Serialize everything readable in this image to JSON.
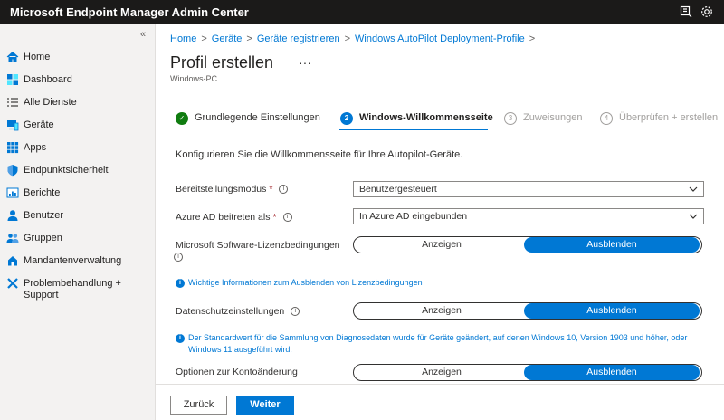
{
  "app": {
    "title": "Microsoft Endpoint Manager Admin Center"
  },
  "sidebar": {
    "collapse": "«",
    "items": [
      {
        "label": "Home",
        "icon": "home-icon"
      },
      {
        "label": "Dashboard",
        "icon": "dashboard-icon"
      },
      {
        "label": "Alle Dienste",
        "icon": "list-icon"
      },
      {
        "label": "Geräte",
        "icon": "devices-icon"
      },
      {
        "label": "Apps",
        "icon": "apps-grid-icon"
      },
      {
        "label": "Endpunktsicherheit",
        "icon": "shield-icon"
      },
      {
        "label": "Berichte",
        "icon": "reports-icon"
      },
      {
        "label": "Benutzer",
        "icon": "user-icon"
      },
      {
        "label": "Gruppen",
        "icon": "group-icon"
      },
      {
        "label": "Mandantenverwaltung",
        "icon": "tenant-icon"
      },
      {
        "label": "Problembehandlung + Support",
        "icon": "tools-icon"
      }
    ]
  },
  "breadcrumb": [
    "Home",
    "Geräte",
    "Geräte registrieren",
    "Windows AutoPilot Deployment-Profile"
  ],
  "breadcrumb_sep": ">",
  "page": {
    "title": "Profil erstellen",
    "more": "···",
    "subtitle": "Windows-PC"
  },
  "wizard": {
    "steps": [
      {
        "number": "✓",
        "label": "Grundlegende Einstellungen",
        "state": "done"
      },
      {
        "number": "2",
        "label": "Windows-Willkommensseite",
        "state": "active"
      },
      {
        "number": "3",
        "label": "Zuweisungen",
        "state": "todo"
      },
      {
        "number": "4",
        "label": "Überprüfen + erstellen",
        "state": "todo"
      }
    ]
  },
  "form": {
    "intro": "Konfigurieren Sie die Willkommensseite für Ihre Autopilot-Geräte.",
    "required_mark": "*",
    "info_glyph": "i",
    "deployment_mode": {
      "label": "Bereitstellungsmodus",
      "value": "Benutzergesteuert"
    },
    "join_azure": {
      "label": "Azure AD beitreten als",
      "value": "In Azure AD eingebunden"
    },
    "license_terms": {
      "label": "Microsoft Software-Lizenzbedingungen",
      "show": "Anzeigen",
      "hide": "Ausblenden",
      "selected": "Ausblenden"
    },
    "license_info": "Wichtige Informationen zum Ausblenden von Lizenzbedingungen",
    "privacy": {
      "label": "Datenschutzeinstellungen",
      "show": "Anzeigen",
      "hide": "Ausblenden",
      "selected": "Ausblenden"
    },
    "privacy_info": "Der Standardwert für die Sammlung von Diagnosedaten wurde für Geräte geändert, auf denen Windows 10, Version 1903 und höher, oder Windows 11 ausgeführt wird.",
    "account_change": {
      "label": "Optionen zur Kontoänderung",
      "show": "Anzeigen",
      "hide": "Ausblenden",
      "selected": "Ausblenden"
    }
  },
  "footer": {
    "back": "Zurück",
    "next": "Weiter"
  },
  "colors": {
    "accent": "#0078d4",
    "topbar": "#1b1a19",
    "success": "#107c10",
    "required": "#a4262c"
  }
}
